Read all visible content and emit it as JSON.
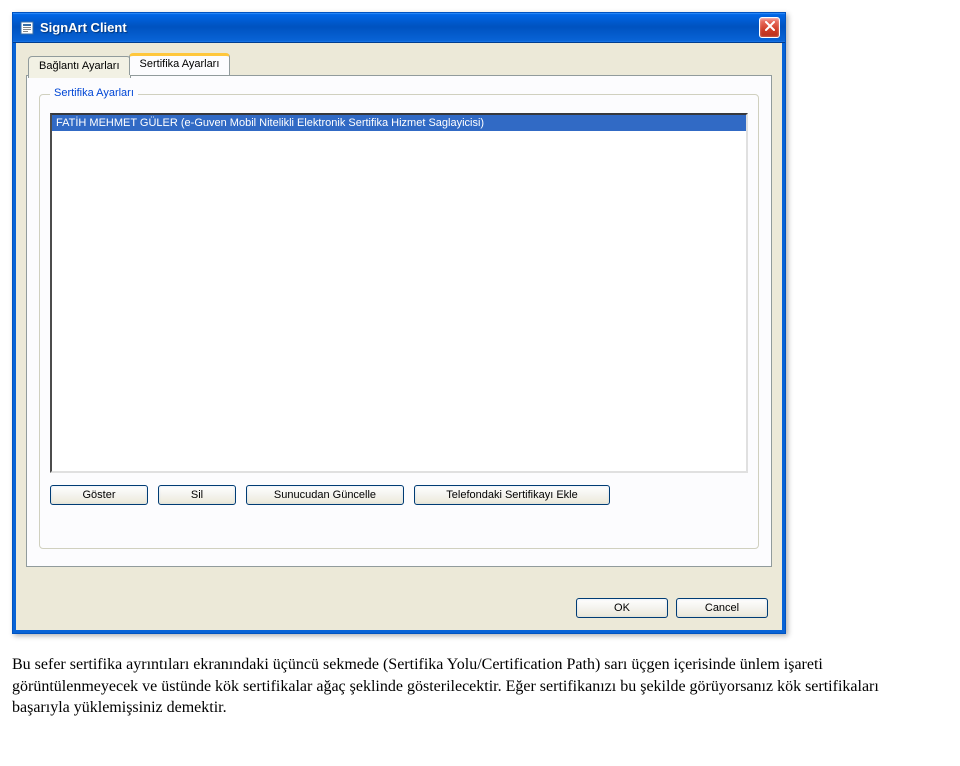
{
  "window": {
    "title": "SignArt Client"
  },
  "tabs": {
    "items": [
      {
        "label": "Bağlantı Ayarları",
        "active": false
      },
      {
        "label": "Sertifika Ayarları",
        "active": true
      }
    ]
  },
  "groupbox": {
    "title": "Sertifika Ayarları"
  },
  "listbox": {
    "items": [
      "FATİH MEHMET GÜLER  (e-Guven Mobil Nitelikli Elektronik Sertifika Hizmet Saglayicisi)"
    ]
  },
  "buttons": {
    "goster": "Göster",
    "sil": "Sil",
    "sunucudan": "Sunucudan Güncelle",
    "telefondaki": "Telefondaki Sertifikayı Ekle",
    "ok": "OK",
    "cancel": "Cancel"
  },
  "body_text": "Bu sefer sertifika ayrıntıları ekranındaki üçüncü sekmede (Sertifika Yolu/Certification Path) sarı üçgen içerisinde ünlem işareti görüntülenmeyecek ve üstünde kök sertifikalar ağaç şeklinde gösterilecektir. Eğer sertifikanızı bu şekilde görüyorsanız kök sertifikaları başarıyla yüklemişsiniz demektir."
}
